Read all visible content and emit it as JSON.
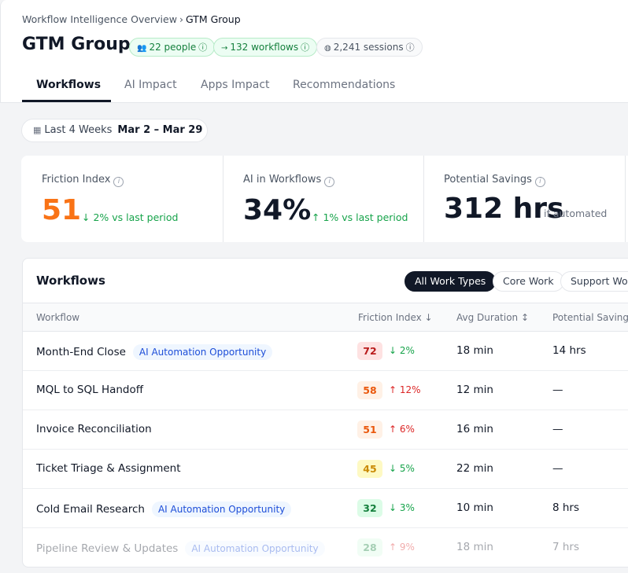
{
  "breadcrumb": {
    "parent": "Workflow Intelligence Overview",
    "separator": "›",
    "current": "GTM Group"
  },
  "page": {
    "title": "GTM Group"
  },
  "pills": [
    {
      "icon": "people-icon",
      "glyph": "👥",
      "label": "22 people",
      "info": "ⓘ"
    },
    {
      "icon": "arrow-right-icon",
      "glyph": "→",
      "label": "132 workflows",
      "info": "ⓘ"
    },
    {
      "icon": "globe-icon",
      "glyph": "◍",
      "label": "2,241 sessions",
      "info": "ⓘ"
    }
  ],
  "tabs": [
    "Workflows",
    "AI Impact",
    "Apps Impact",
    "Recommendations"
  ],
  "date_filter": {
    "label": "Last 4 Weeks",
    "range": "Mar 2 – Mar 29",
    "icon": "calendar-icon"
  },
  "kpis": {
    "friction": {
      "label": "Friction Index",
      "value": "51",
      "delta": "↓ 2% vs last period",
      "value_color": "#f97316"
    },
    "ai": {
      "label": "AI in Workflows",
      "value": "34%",
      "delta": "↑ 1% vs last period"
    },
    "savings": {
      "label": "Potential Savings",
      "value": "312 hrs",
      "sub": "if automated"
    }
  },
  "workflows": {
    "title": "Workflows",
    "filters": [
      "All Work Types",
      "Core Work",
      "Support Work"
    ],
    "columns": {
      "workflow": "Workflow",
      "friction": "Friction Index ↓",
      "duration": "Avg Duration ↕",
      "savings": "Potential Savings"
    },
    "rows": [
      {
        "name": "Month-End Close",
        "tag": "AI Automation Opportunity",
        "fi": "72",
        "delta": "↓ 2%",
        "duration": "18 min",
        "savings": "14 hrs"
      },
      {
        "name": "MQL to SQL Handoff",
        "tag": "",
        "fi": "58",
        "delta": "↑ 12%",
        "duration": "12 min",
        "savings": "—"
      },
      {
        "name": "Invoice Reconciliation",
        "tag": "",
        "fi": "51",
        "delta": "↑ 6%",
        "duration": "16 min",
        "savings": "—"
      },
      {
        "name": "Ticket Triage & Assignment",
        "tag": "",
        "fi": "45",
        "delta": "↓ 5%",
        "duration": "22 min",
        "savings": "—"
      },
      {
        "name": "Cold Email Research",
        "tag": "AI Automation Opportunity",
        "fi": "32",
        "delta": "↓ 3%",
        "duration": "10 min",
        "savings": "8 hrs"
      },
      {
        "name": "Pipeline Review & Updates",
        "tag": "AI Automation Opportunity",
        "fi": "28",
        "delta": "↑ 9%",
        "duration": "18 min",
        "savings": "7 hrs"
      }
    ]
  },
  "colors": {
    "fi_red_bg": "#fee2e2",
    "fi_red": "#b91c1c",
    "fi_orange_bg": "#fff1e6",
    "fi_orange": "#ea580c",
    "fi_amber_bg": "#fef9c3",
    "fi_amber": "#ca8a04",
    "fi_green_bg": "#dcfce7",
    "fi_green": "#15803d"
  }
}
